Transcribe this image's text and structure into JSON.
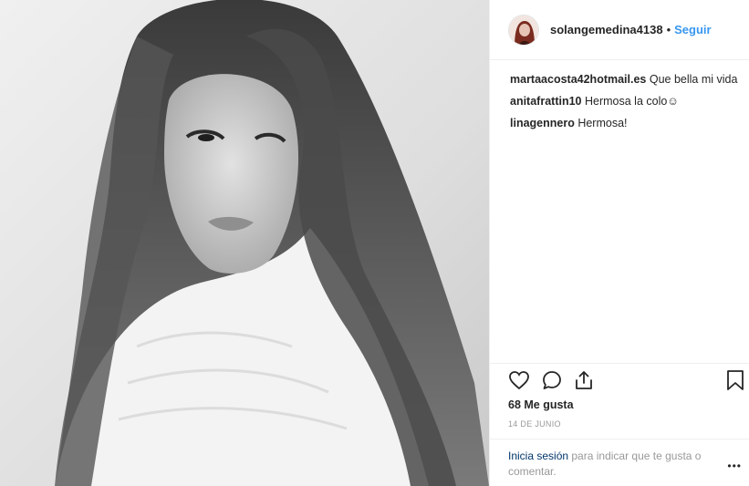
{
  "post": {
    "image": {
      "alt": "",
      "palette": {
        "bg": "#e4e4e4",
        "hair": "#2b2b2b",
        "skin": "#cfcfcf",
        "sweater": "#f4f4f4"
      }
    },
    "author": {
      "username": "solangemedina4138",
      "separator": "•",
      "follow_label": "Seguir"
    },
    "comments": [
      {
        "user": "martaacosta42hotmail.es",
        "text": "Que bella mi vida"
      },
      {
        "user": "anitafrattin10",
        "text": "Hermosa la colo☺"
      },
      {
        "user": "linagennero",
        "text": "Hermosa!"
      }
    ],
    "actions": {
      "like_icon": "heart-icon",
      "comment_icon": "comment-bubble-icon",
      "share_icon": "share-icon",
      "save_icon": "bookmark-icon"
    },
    "likes_label": "68 Me gusta",
    "date_label": "14 DE JUNIO",
    "login_prompt": {
      "link": "Inicia sesión",
      "text": " para indicar que te gusta o comentar."
    },
    "more_label": "•••",
    "colors": {
      "accent": "#3897f0",
      "link_dark": "#003569",
      "muted": "#999999",
      "border": "#efefef"
    }
  }
}
